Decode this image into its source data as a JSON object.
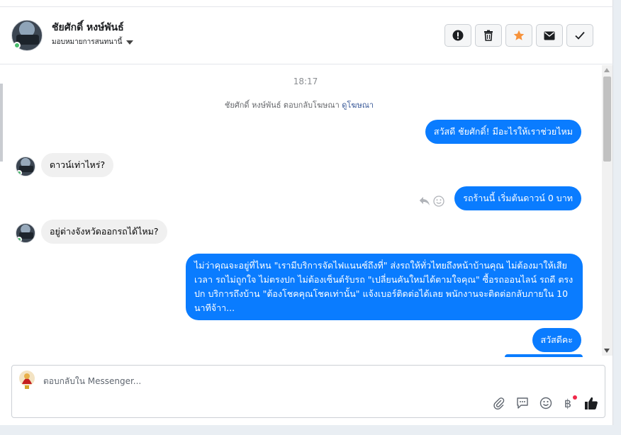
{
  "header": {
    "contact_name": "ชัยศักดิ์ หงษ์พันธ์",
    "assign_label": "มอบหมายการสนทนานี้",
    "buttons": [
      {
        "name": "spam-button",
        "icon": "exclamation-circle-icon"
      },
      {
        "name": "delete-button",
        "icon": "trash-icon"
      },
      {
        "name": "star-button",
        "icon": "star-icon",
        "color": "#f7923b"
      },
      {
        "name": "mark-unread-button",
        "icon": "envelope-icon"
      },
      {
        "name": "done-button",
        "icon": "check-icon"
      }
    ]
  },
  "conversation": {
    "timestamp": "18:17",
    "notice_text": "ชัยศักดิ์ หงษ์พันธ์ ตอบกลับโฆษณา ",
    "notice_link": "ดูโฆษณา",
    "messages": [
      {
        "direction": "out",
        "text": "สวัสดี ชัยศักดิ์! มีอะไรให้เราช่วยไหม"
      },
      {
        "direction": "in",
        "text": "ดาวน์เท่าไหร่?"
      },
      {
        "direction": "out",
        "text": "รถร้านนี้ เริ่มต้นดาวน์ 0 บาท"
      },
      {
        "direction": "in",
        "text": "อยู่ต่างจังหวัดออกรถได้ไหม?"
      },
      {
        "direction": "out",
        "text": "ไม่ว่าคุณจะอยู่ที่ไหน \"เรามีบริการจัดไฟแนนซ์ถึงที่\"  ส่งรถให้ทั่วไทยถึงหน้าบ้านคุณ ไม่ต้องมาให้เสียเวลา รถไม่ถูกใจ ไม่ตรงปก ไม่ต้องเซ็นต์รับรถ \"เปลี่ยนคันใหม่ได้ตามใจคุณ\" ซื้อรถออนไลน์ รถดี ตรงปก บริการถึงบ้าน \"ต้องโชคคุณโชคเท่านั้น\" แจ้งเบอร์ติดต่อได้เลย พนักงานจะติดต่อกลับภายใน 10 นาทีจ้าา..."
      },
      {
        "direction": "out",
        "text": "สวัสดีคะ"
      }
    ]
  },
  "composer": {
    "placeholder": "ตอบกลับใน Messenger...",
    "tools": [
      "paperclip-icon",
      "saved-reply-icon",
      "emoji-icon",
      "baht-payment-icon",
      "thumbs-up-icon"
    ],
    "baht_symbol": "฿"
  },
  "colors": {
    "outgoing_bubble": "#0a7cff",
    "incoming_bubble": "#f0f0f0",
    "link": "#385898"
  }
}
